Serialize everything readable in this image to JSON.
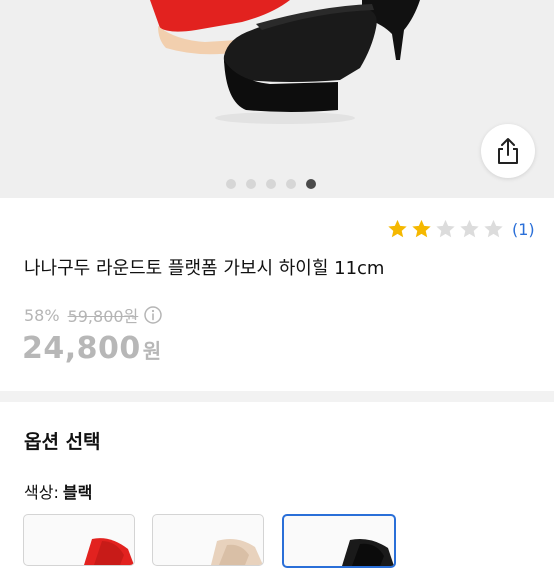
{
  "gallery": {
    "total_images": 5,
    "active_index": 4,
    "share_icon": "share-icon"
  },
  "product": {
    "rating": {
      "score": 2,
      "max": 5,
      "count_text": "(1)"
    },
    "title": "나나구두 라운드토 플랫폼 가보시 하이힐 11cm",
    "discount_text": "58%",
    "original_price_text": "59,800원",
    "price_number": "24,800",
    "price_unit": "원"
  },
  "options": {
    "section_title": "옵션 선택",
    "color_label": "색상:",
    "color_value": "블랙",
    "swatches": [
      {
        "name": "red",
        "selected": false
      },
      {
        "name": "beige",
        "selected": false
      },
      {
        "name": "black",
        "selected": true
      }
    ]
  },
  "colors": {
    "accent_blue": "#2a6fd8",
    "star_filled": "#f5b800",
    "star_empty": "#dcdcdc",
    "price_gray": "#b7b7b7"
  }
}
